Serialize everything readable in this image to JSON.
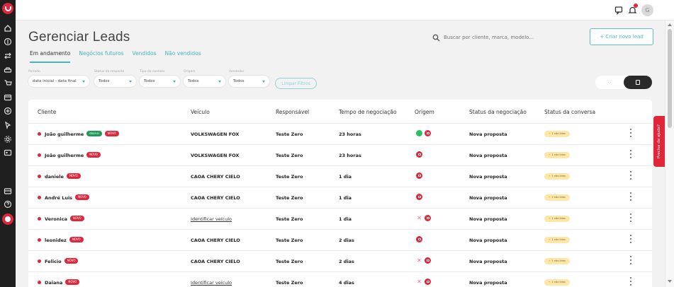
{
  "page": {
    "title": "Gerenciar Leads",
    "search_placeholder": "Buscar por cliente, marca, modelo...",
    "create_button": "+ Criar novo lead"
  },
  "tabs": [
    {
      "label": "Em andamento",
      "active": true
    },
    {
      "label": "Negócios futuros",
      "active": false
    },
    {
      "label": "Vendidos",
      "active": false
    },
    {
      "label": "Não vendidos",
      "active": false
    }
  ],
  "filters": {
    "periodo": {
      "label": "Período",
      "value": "data inicial - data final"
    },
    "status_resposta": {
      "label": "Status da resposta",
      "value": "Todos"
    },
    "tipo_contato": {
      "label": "Tipo de contato",
      "value": "Todos"
    },
    "origem": {
      "label": "Origem",
      "value": "Todos"
    },
    "vendedor": {
      "label": "Vendedor",
      "value": "Todos"
    },
    "clear_label": "Limpar Filtros"
  },
  "table": {
    "headers": {
      "cliente": "Cliente",
      "veiculo": "Veículo",
      "responsavel": "Responsável",
      "tempo": "Tempo de negociação",
      "origem": "Origem",
      "status_negociacao": "Status da negociação",
      "status_conversa": "Status da conversa"
    },
    "rows": [
      {
        "cliente": "João guilherme",
        "tags": [
          "deal-ai",
          "NOVO"
        ],
        "veiculo": "VOLKSWAGEN FOX",
        "responsavel": "Teste Zero",
        "tempo": "23 horas",
        "origem": [
          "whatsapp",
          "site"
        ],
        "status": "Nova proposta",
        "conversa": "1 não lidas"
      },
      {
        "cliente": "João guilherme",
        "tags": [
          "NOVO"
        ],
        "veiculo": "VOLKSWAGEN FOX",
        "responsavel": "Teste Zero",
        "tempo": "23 horas",
        "origem": [
          "site"
        ],
        "status": "Nova proposta",
        "conversa": "1 não lidas"
      },
      {
        "cliente": "daniele",
        "tags": [
          "NOVO"
        ],
        "veiculo": "CAOA CHERY CIELO",
        "responsavel": "Teste Zero",
        "tempo": "1 dia",
        "origem": [
          "site"
        ],
        "status": "Nova proposta",
        "conversa": "1 não lidas"
      },
      {
        "cliente": "André Luis",
        "tags": [
          "NOVO"
        ],
        "veiculo": "CAOA CHERY CIELO",
        "responsavel": "Teste Zero",
        "tempo": "1 dia",
        "origem": [
          "site"
        ],
        "status": "Nova proposta",
        "conversa": "2 não lidas"
      },
      {
        "cliente": "Veronica",
        "tags": [
          "NOVO"
        ],
        "veiculo": "Identificar veículo",
        "responsavel": "Teste Zero",
        "tempo": "1 dia",
        "origem": [
          "cross",
          "site"
        ],
        "status": "Nova proposta",
        "conversa": "1 não lidas"
      },
      {
        "cliente": "leonidez",
        "tags": [
          "NOVO"
        ],
        "veiculo": "CAOA CHERY CIELO",
        "responsavel": "Teste Zero",
        "tempo": "2 dias",
        "origem": [
          "site"
        ],
        "status": "Nova proposta",
        "conversa": "1 não lidas"
      },
      {
        "cliente": "Felicio",
        "tags": [
          "NOVO"
        ],
        "veiculo": "CAOA CHERY CIELO",
        "responsavel": "Teste Zero",
        "tempo": "2 dias",
        "origem": [
          "cross",
          "site"
        ],
        "status": "Nova proposta",
        "conversa": "1 não lidas"
      },
      {
        "cliente": "Daiana",
        "tags": [
          "NOVO"
        ],
        "veiculo": "Identificar veículo",
        "responsavel": "Teste Zero",
        "tempo": "4 dias",
        "origem": [
          "cross",
          "site"
        ],
        "status": "Nova proposta",
        "conversa": "1 não lidas"
      }
    ]
  },
  "help_tab": "Precisa de ajuda?",
  "topbar": {
    "user_initial": "G"
  },
  "colors": {
    "accent": "#45b5bc",
    "brand_red": "#e0263a",
    "dark": "#1f1f1f"
  }
}
